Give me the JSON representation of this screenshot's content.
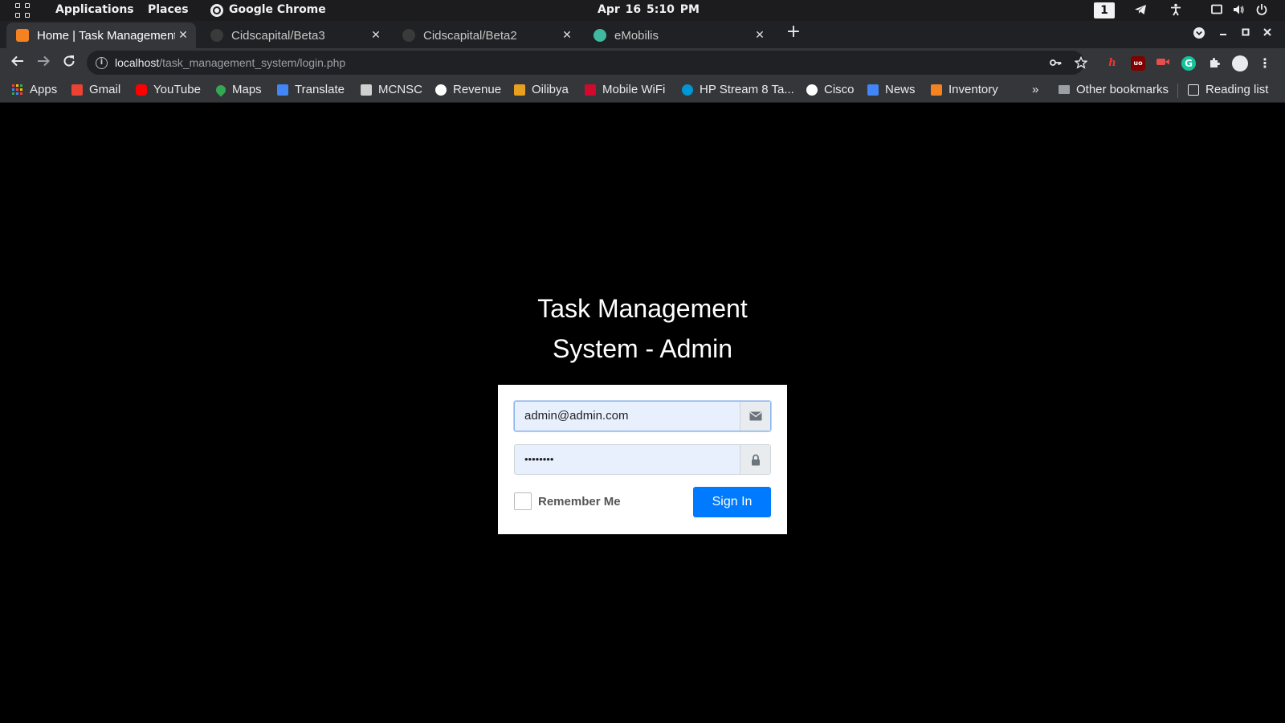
{
  "system_bar": {
    "applications_label": "Applications",
    "places_label": "Places",
    "app_label": "Google Chrome",
    "clock": "Apr 16   5:10 PM",
    "workspace": "1"
  },
  "tabs": [
    {
      "title": "Home | Task Management System",
      "active": true,
      "favicon_color": "#f58220"
    },
    {
      "title": "Cidscapital/Beta3",
      "active": false,
      "favicon_color": "#444444"
    },
    {
      "title": "Cidscapital/Beta2",
      "active": false,
      "favicon_color": "#444444"
    },
    {
      "title": "eMobilis",
      "active": false,
      "favicon_color": "#3fb9a0"
    }
  ],
  "address_bar": {
    "host": "localhost",
    "path": "/task_management_system/login.php"
  },
  "bookmarks": [
    {
      "label": "Apps",
      "icon": "apps-grid-icon"
    },
    {
      "label": "Gmail",
      "icon": "gmail-icon",
      "color": "#ea4335"
    },
    {
      "label": "YouTube",
      "icon": "youtube-icon",
      "color": "#ff0000"
    },
    {
      "label": "Maps",
      "icon": "maps-pin-icon",
      "color": "#34a853"
    },
    {
      "label": "Translate",
      "icon": "translate-icon",
      "color": "#4285f4"
    },
    {
      "label": "MCNSC",
      "icon": "mcnsc-icon",
      "color": "#d0d0d0"
    },
    {
      "label": "Revenue",
      "icon": "revenue-icon",
      "color": "#ffffff"
    },
    {
      "label": "Oilibya",
      "icon": "oilibya-icon",
      "color": "#e8a020"
    },
    {
      "label": "Mobile WiFi",
      "icon": "huawei-icon",
      "color": "#cf0a2c"
    },
    {
      "label": "HP Stream 8 Ta...",
      "icon": "hp-icon",
      "color": "#0096d6"
    },
    {
      "label": "Cisco",
      "icon": "globe-icon",
      "color": "#ffffff"
    },
    {
      "label": "News",
      "icon": "news-icon",
      "color": "#4285f4"
    },
    {
      "label": "Inventory",
      "icon": "inventory-icon",
      "color": "#f58220"
    }
  ],
  "bookmarks_overflow": "»",
  "other_bookmarks": "Other bookmarks",
  "reading_list": "Reading list",
  "login": {
    "title_line1": "Task Management",
    "title_line2": "System - Admin",
    "email_value": "admin@admin.com",
    "password_value": "••••••••",
    "remember_label": "Remember Me",
    "remember_checked": false,
    "signin_label": "Sign In",
    "accent_color": "#007bff"
  }
}
